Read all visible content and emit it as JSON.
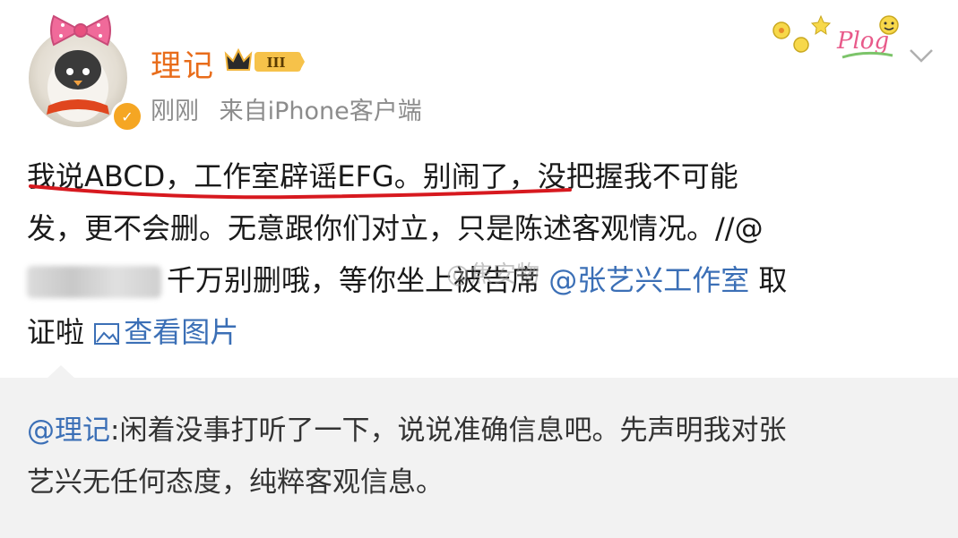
{
  "header": {
    "username": "理记",
    "level_badge": "III",
    "time": "刚刚",
    "source": "来自iPhone客户端",
    "plog_label": "Plog"
  },
  "post": {
    "line1": "我说ABCD，工作室辟谣EFG。别闹了，没把握我不可能",
    "line2": "发，更不会删。无意跟你们对立，只是陈述客观情况。//@",
    "line3_text": "千万别删哦，等你坐上被告席 ",
    "line3_mention": "@张艺兴工作室",
    "line3_tail": " 取",
    "line4_text": "证啦 ",
    "view_pictures": "查看图片",
    "watermark": "@焦安物"
  },
  "quote": {
    "mention": "@理记",
    "line1_rest": ":闲着没事打听了一下，说说准确信息吧。先声明我对张",
    "line2": "艺兴无任何态度，纯粹客观信息。"
  },
  "colors": {
    "username": "#e86c1a",
    "link": "#3b6fb6",
    "underline": "#d7191f",
    "quote_bg": "#f2f2f2"
  }
}
